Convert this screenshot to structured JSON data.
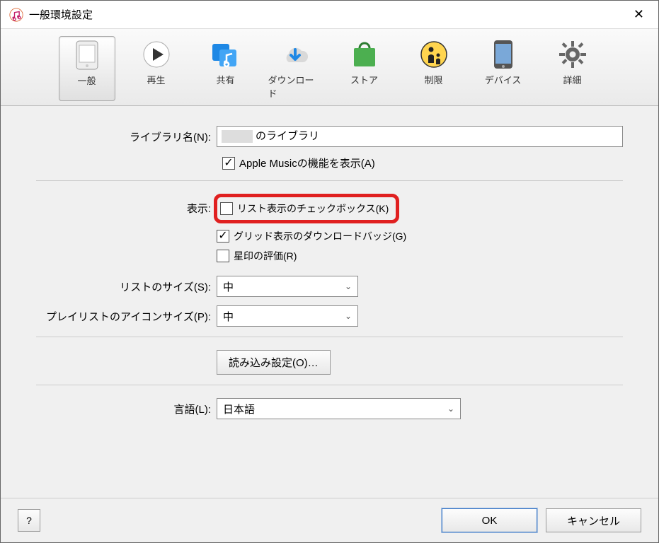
{
  "window": {
    "title": "一般環境設定"
  },
  "tabs": {
    "general": "一般",
    "playback": "再生",
    "sharing": "共有",
    "downloads": "ダウンロード",
    "store": "ストア",
    "restrictions": "制限",
    "devices": "デバイス",
    "advanced": "詳細"
  },
  "labels": {
    "library_name": "ライブラリ名(N):",
    "display": "表示:",
    "list_size": "リストのサイズ(S):",
    "playlist_icon_size": "プレイリストのアイコンサイズ(P):",
    "language": "言語(L):"
  },
  "values": {
    "library_suffix": "のライブラリ",
    "apple_music_show": "Apple Musicの機能を表示(A)",
    "list_checkbox": "リスト表示のチェックボックス(K)",
    "grid_download_badge": "グリッド表示のダウンロードバッジ(G)",
    "star_rating": "星印の評価(R)",
    "list_size_value": "中",
    "playlist_icon_size_value": "中",
    "import_settings_btn": "読み込み設定(O)…",
    "language_value": "日本語"
  },
  "footer": {
    "help": "?",
    "ok": "OK",
    "cancel": "キャンセル"
  }
}
